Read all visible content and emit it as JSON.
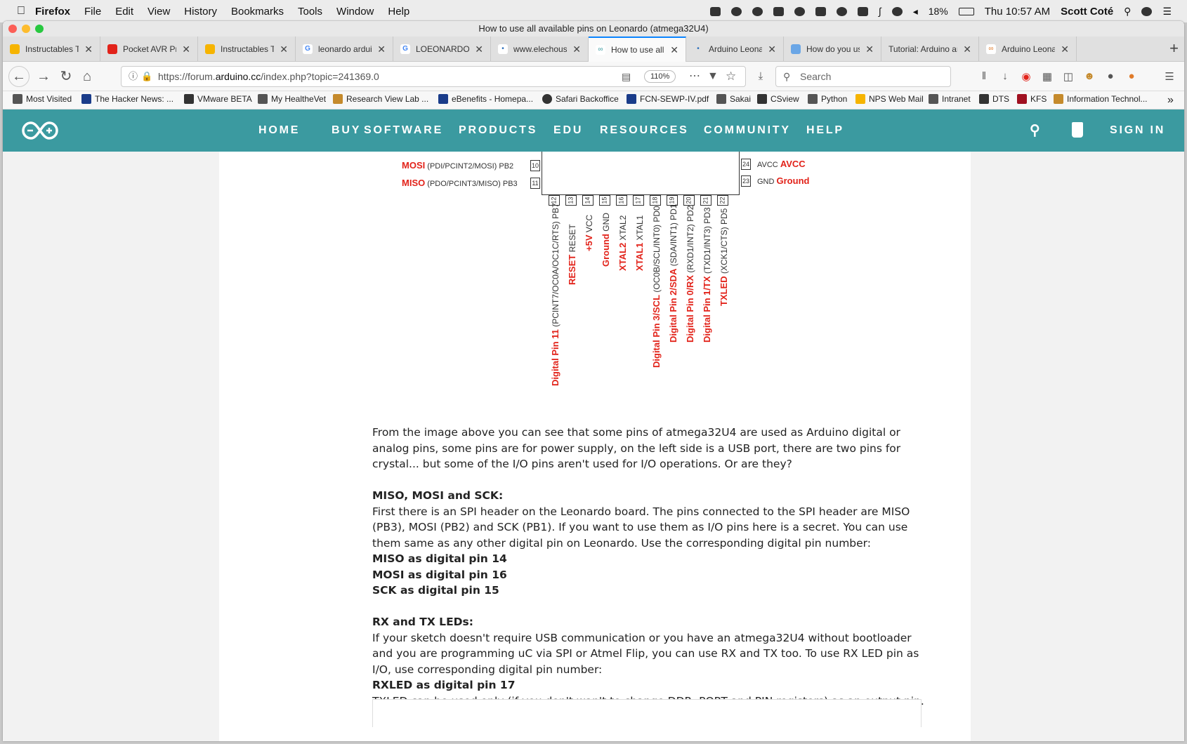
{
  "menubar": {
    "app": "Firefox",
    "menus": [
      "File",
      "Edit",
      "View",
      "History",
      "Bookmarks",
      "Tools",
      "Window",
      "Help"
    ],
    "battery": "18%",
    "clock": "Thu 10:57 AM",
    "user": "Scott Coté"
  },
  "window": {
    "title": "How to use all available pins on Leonardo (atmega32U4)"
  },
  "tabs": [
    {
      "label": "Instructables Top",
      "color": "#f6b400",
      "active": false
    },
    {
      "label": "Pocket AVR Prog",
      "color": "#e2231a",
      "active": false
    },
    {
      "label": "Instructables Top",
      "color": "#f6b400",
      "active": false
    },
    {
      "label": "leonardo arduino",
      "color": "#4285f4",
      "active": false
    },
    {
      "label": "LOEONARDO MC",
      "color": "#4285f4",
      "active": false
    },
    {
      "label": "www.elechouse.c",
      "color": "#2a6ebb",
      "active": false
    },
    {
      "label": "How to use all av",
      "color": "#3b9aa0",
      "active": true
    },
    {
      "label": "Arduino Leonardo",
      "color": "#2a6ebb",
      "active": false
    },
    {
      "label": "How do you use",
      "color": "#6aa6e6",
      "active": false
    },
    {
      "label": "Tutorial: Arduino and",
      "color": "#cccccc",
      "active": false
    },
    {
      "label": "Arduino Leonardo",
      "color": "#e07b2a",
      "active": false
    }
  ],
  "address": {
    "url_prefix": "https://forum.",
    "url_domain": "arduino.cc",
    "url_path": "/index.php?topic=241369.0",
    "zoom": "110%",
    "search_placeholder": "Search"
  },
  "bookmarks": [
    {
      "label": "Most Visited",
      "color": "#555555"
    },
    {
      "label": "The Hacker News: ...",
      "color": "#1a3c8a"
    },
    {
      "label": "VMware BETA",
      "color": "#333333"
    },
    {
      "label": "My HealtheVet",
      "color": "#555555"
    },
    {
      "label": "Research View Lab ...",
      "color": "#c58a2c"
    },
    {
      "label": "eBenefits - Homepa...",
      "color": "#1a3c8a"
    },
    {
      "label": "Safari Backoffice",
      "color": "#333333"
    },
    {
      "label": "FCN-SEWP-IV.pdf",
      "color": "#1a3c8a"
    },
    {
      "label": "Sakai",
      "color": "#555555"
    },
    {
      "label": "CSview",
      "color": "#333333"
    },
    {
      "label": "Python",
      "color": "#555555"
    },
    {
      "label": "NPS Web Mail",
      "color": "#f6b400"
    },
    {
      "label": "Intranet",
      "color": "#555555"
    },
    {
      "label": "DTS",
      "color": "#333333"
    },
    {
      "label": "KFS",
      "color": "#a01020"
    },
    {
      "label": "Information Technol...",
      "color": "#c58a2c"
    }
  ],
  "site_nav": {
    "items": [
      "HOME",
      "BUY",
      "SOFTWARE",
      "PRODUCTS",
      "EDU",
      "RESOURCES",
      "COMMUNITY",
      "HELP"
    ],
    "sign_in": "SIGN IN",
    "brand_color": "#3b9aa0"
  },
  "diagram": {
    "left_pins": [
      {
        "red": "MOSI",
        "desc": "(PDI/PCINT2/MOSI) PB2",
        "num": "10"
      },
      {
        "red": "MISO",
        "desc": "(PDO/PCINT3/MISO) PB3",
        "num": "11"
      }
    ],
    "right_pins": [
      {
        "num": "24",
        "desc": "AVCC",
        "red": "AVCC"
      },
      {
        "num": "23",
        "desc": "GND",
        "red": "Ground"
      }
    ],
    "bottom_pins": [
      {
        "num": "12",
        "red": "Digital Pin 11",
        "desc": "(PCINT7/OC0A/OC1C/RTS) PB7"
      },
      {
        "num": "13",
        "red": "RESET",
        "desc": "RESET"
      },
      {
        "num": "14",
        "red": "+5V",
        "desc": "VCC"
      },
      {
        "num": "15",
        "red": "Ground",
        "desc": "GND"
      },
      {
        "num": "16",
        "red": "XTAL2",
        "desc": "XTAL2"
      },
      {
        "num": "17",
        "red": "XTAL1",
        "desc": "XTAL1"
      },
      {
        "num": "18",
        "red": "Digital Pin 3/SCL",
        "desc": "(OC0B/SCL/INT0) PD0"
      },
      {
        "num": "19",
        "red": "Digital Pin 2/SDA",
        "desc": "(SDA/INT1) PD1"
      },
      {
        "num": "20",
        "red": "Digital Pin 0/RX",
        "desc": "(RXD1/INT2) PD2"
      },
      {
        "num": "21",
        "red": "Digital Pin 1/TX",
        "desc": "(TXD1/INT3) PD3"
      },
      {
        "num": "22",
        "red": "TXLED",
        "desc": "(XCK1/CTS) PD5"
      }
    ]
  },
  "article": {
    "intro": "From the image above you can see that some pins of atmega32U4 are used as Arduino digital or analog pins, some pins are for power supply, on the left side is a USB port, there are two pins for crystal... but some of the I/O pins aren't used for I/O operations. Or are they?",
    "spi_heading": "MISO, MOSI and SCK:",
    "spi_text": "First there is an SPI header on the Leonardo board. The pins connected to the SPI header are MISO (PB3), MOSI (PB2) and SCK (PB1). If you want to use them as I/O pins here is a secret. You can use them same as any other digital pin on Leonardo. Use the corresponding digital pin number:",
    "spi_map": [
      "MISO as digital pin 14",
      "MOSI as digital pin 16",
      "SCK as digital pin 15"
    ],
    "led_heading": "RX and TX LEDs:",
    "led_text": "If your sketch doesn't require USB communication or you have an atmega32U4 without bootloader and you are programming uC via SPI or Atmel Flip, you can use RX and TX too. To use RX LED pin as I/O, use corresponding digital pin number:",
    "rxled": "RXLED as digital pin 17",
    "txled_text": "TXLED can be used only (if you don't wan't to change DDR, PORT and PIN registers) as an output pin. Commands for controlling TXLED pin are:"
  }
}
